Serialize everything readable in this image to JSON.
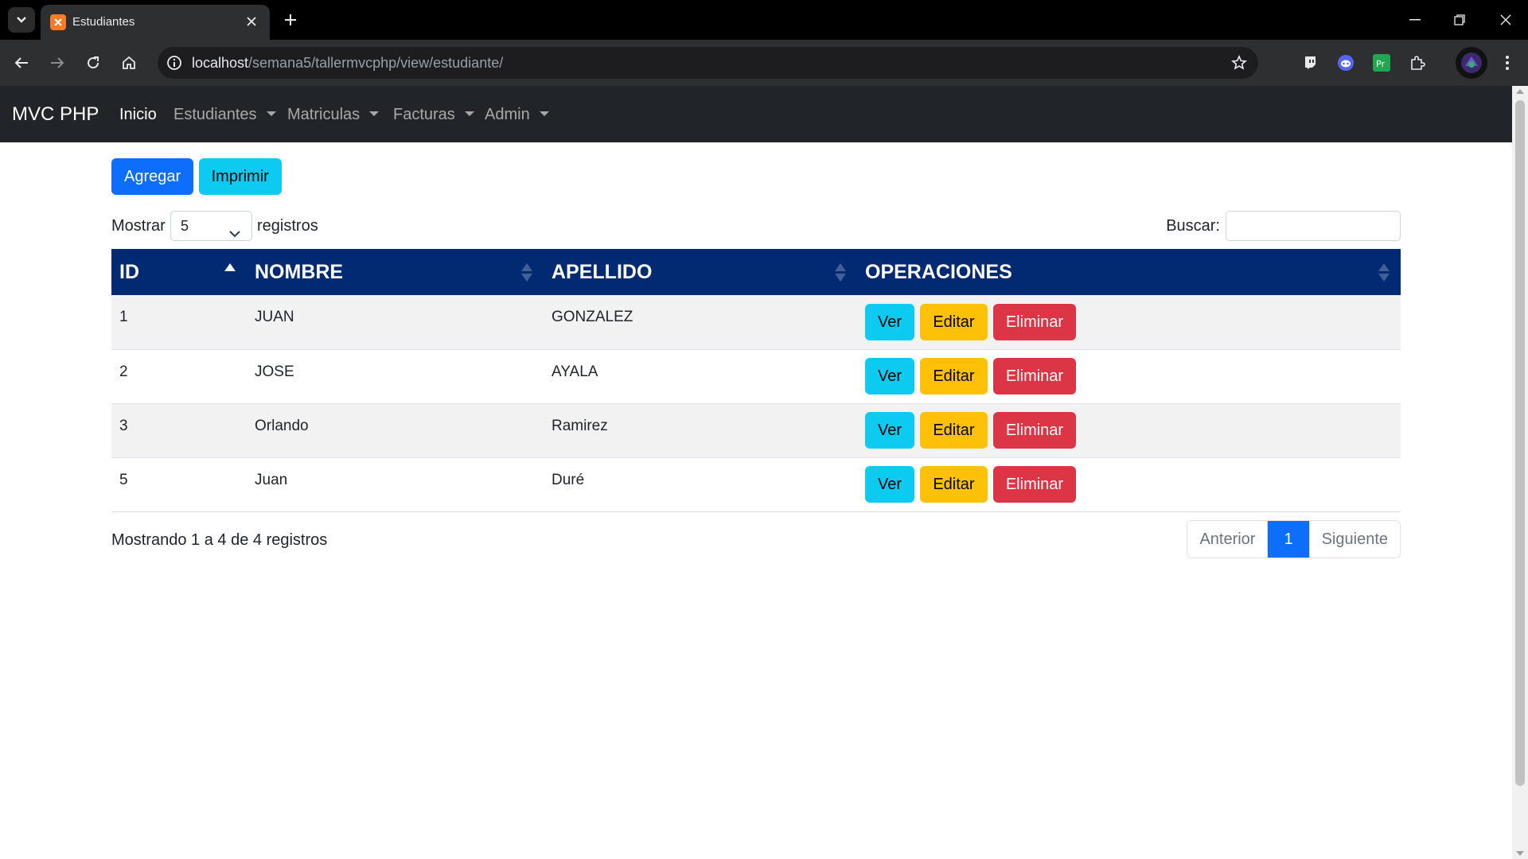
{
  "browser": {
    "tab_title": "Estudiantes",
    "url_host": "localhost",
    "url_path": "/semana5/tallermvcphp/view/estudiante/",
    "icons": [
      "tab-search-icon",
      "xampp-favicon-icon",
      "close-icon",
      "plus-icon",
      "minimize-icon",
      "restore-icon",
      "close-window-icon",
      "back-icon",
      "forward-icon",
      "reload-icon",
      "home-icon",
      "site-info-icon",
      "star-icon",
      "twitch-icon",
      "discord-icon",
      "premiere-icon",
      "extensions-icon",
      "profile-avatar",
      "kebab-menu-icon"
    ]
  },
  "navbar": {
    "brand": "MVC PHP",
    "items": [
      {
        "label": "Inicio"
      },
      {
        "label": "Estudiantes"
      },
      {
        "label": "Matriculas"
      },
      {
        "label": "Facturas"
      },
      {
        "label": "Admin"
      }
    ]
  },
  "actions": {
    "add_label": "Agregar",
    "print_label": "Imprimir"
  },
  "controls": {
    "length_prefix": "Mostrar",
    "length_value": "5",
    "length_suffix": "registros",
    "search_label": "Buscar:",
    "search_value": ""
  },
  "table": {
    "columns": [
      "ID",
      "NOMBRE",
      "APELLIDO",
      "OPERACIONES"
    ],
    "rows": [
      {
        "id": "1",
        "nombre": "JUAN",
        "apellido": "GONZALEZ"
      },
      {
        "id": "2",
        "nombre": "JOSE",
        "apellido": "AYALA"
      },
      {
        "id": "3",
        "nombre": "Orlando",
        "apellido": "Ramirez"
      },
      {
        "id": "5",
        "nombre": "Juan",
        "apellido": "Duré"
      }
    ],
    "op_view": "Ver",
    "op_edit": "Editar",
    "op_delete": "Eliminar"
  },
  "footer": {
    "info": "Mostrando 1 a 4 de 4 registros",
    "prev": "Anterior",
    "current_page": "1",
    "next": "Siguiente"
  },
  "colors": {
    "primary": "#0d6efd",
    "info": "#0dcaf0",
    "warning": "#ffc107",
    "danger": "#dc3545",
    "table_header": "#012a73",
    "navbar": "#212529"
  }
}
